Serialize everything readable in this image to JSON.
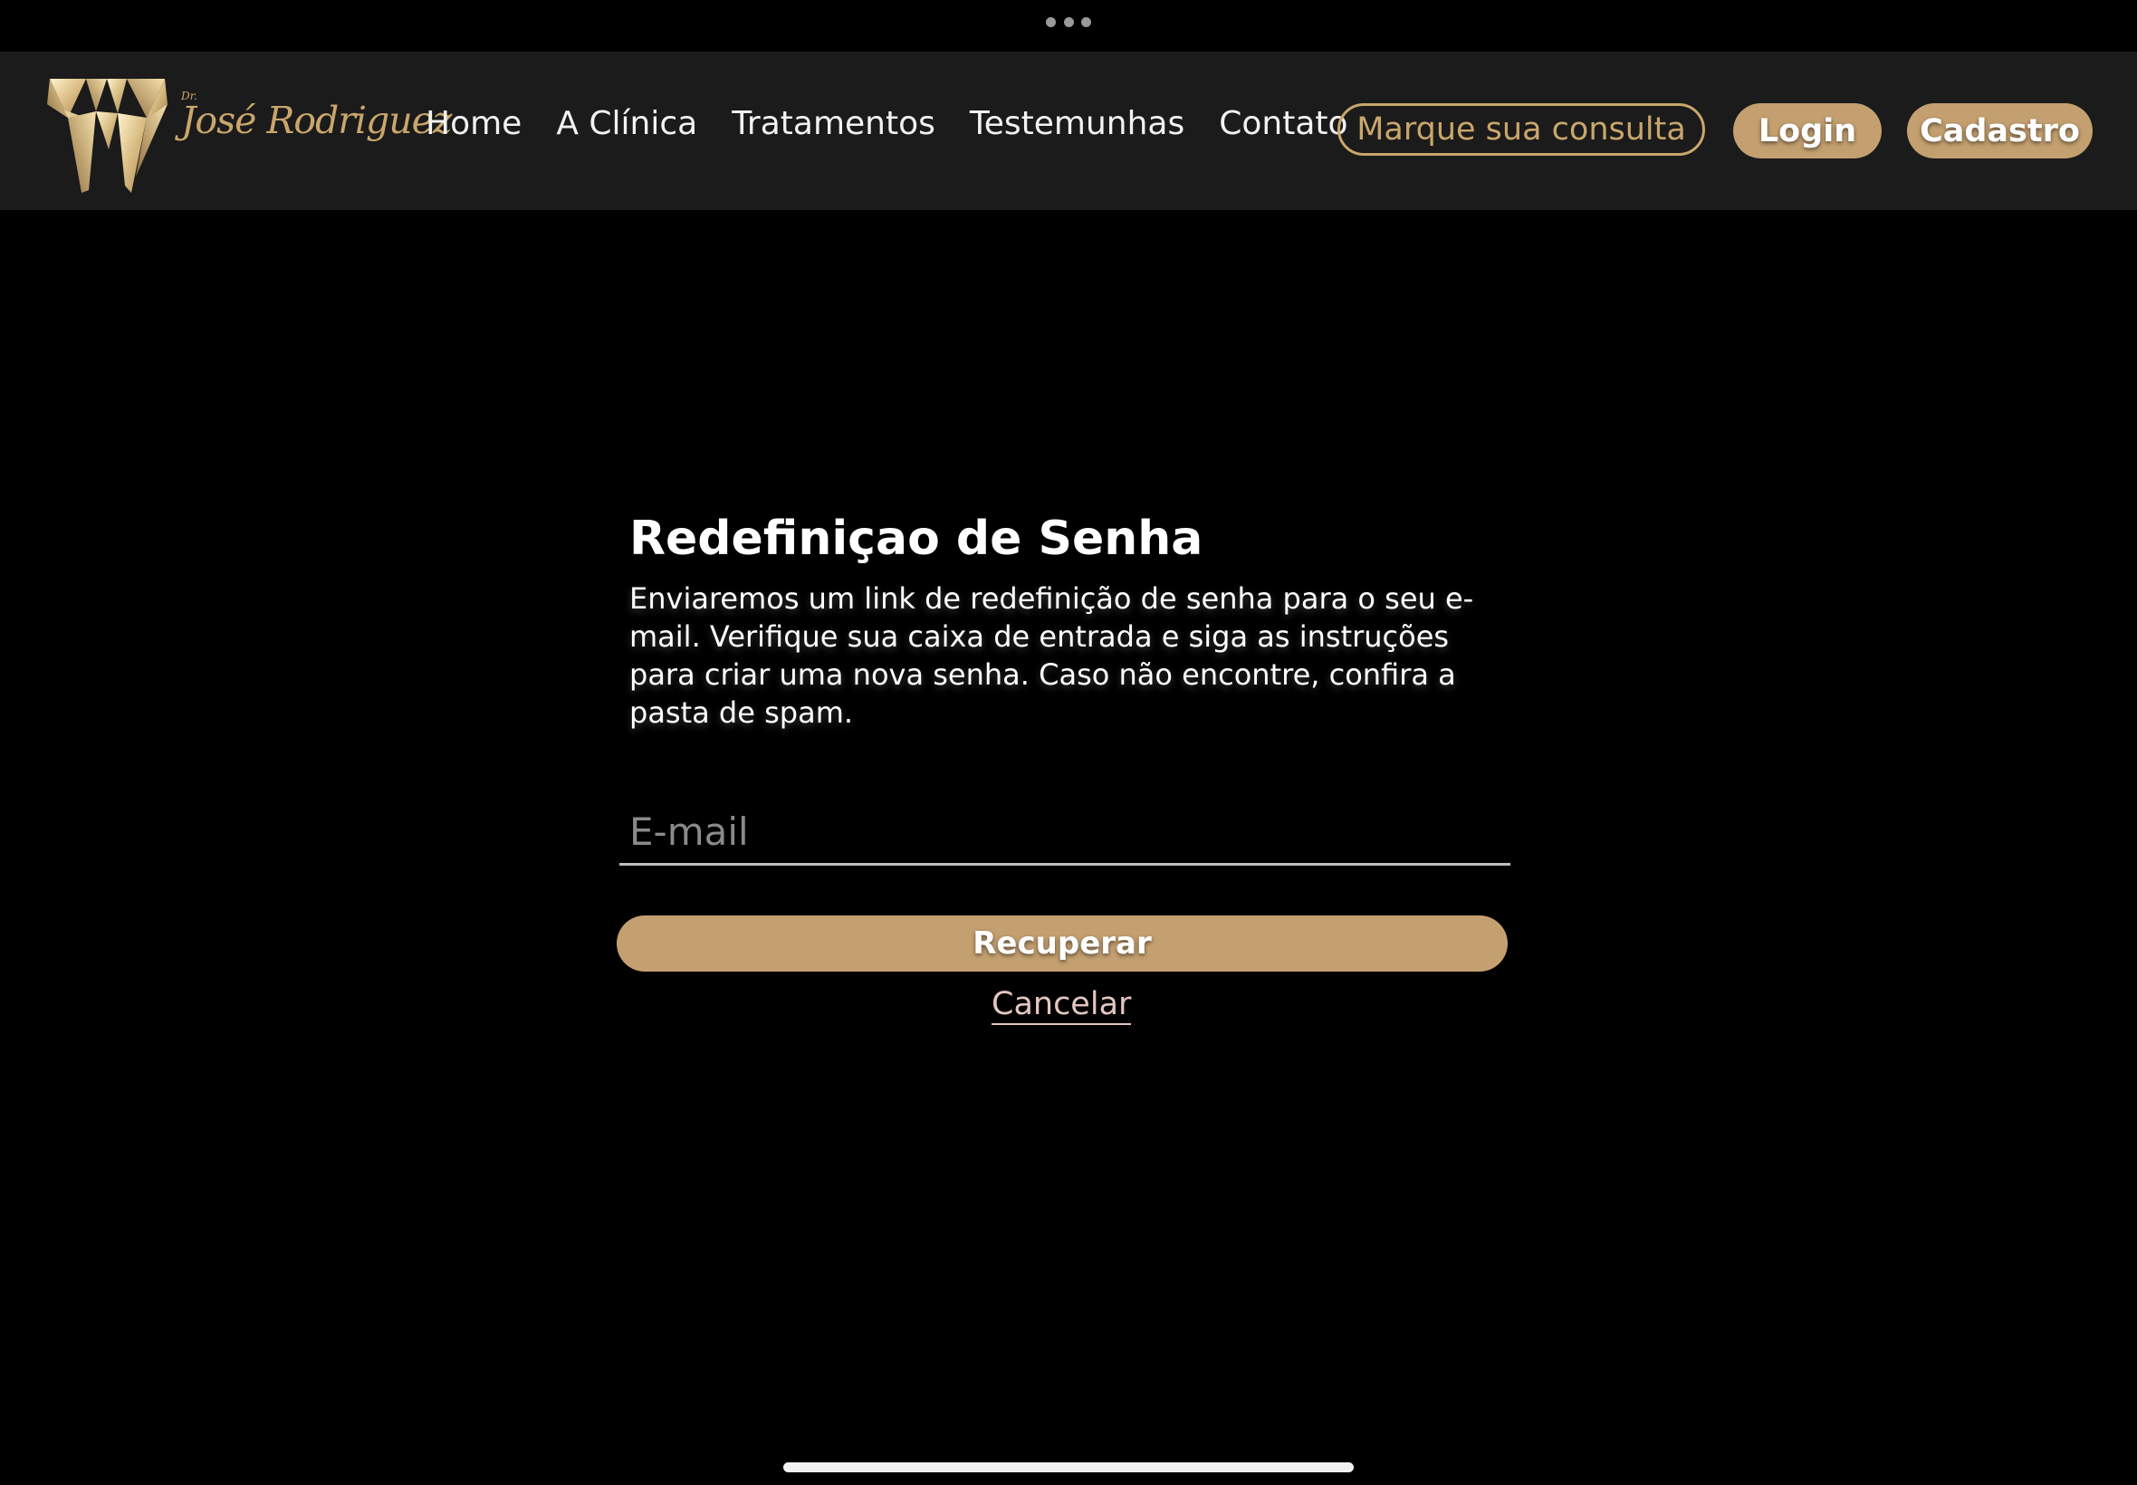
{
  "brand": {
    "prefix": "Dr.",
    "name": "José Rodriguez",
    "colors": {
      "gold": "#c9a66b",
      "button": "#c4a070",
      "navbar": "#1b1b1b",
      "background": "#000000"
    },
    "logo_icon": "diamond-tooth-logo"
  },
  "nav": {
    "links": [
      "Home",
      "A Clínica",
      "Tratamentos",
      "Testemunhas",
      "Contato"
    ],
    "appointment_button": "Marque sua consulta",
    "login_button": "Login",
    "signup_button": "Cadastro"
  },
  "reset": {
    "title": "Redefiniçao de Senha",
    "description": "Enviaremos um link de redefinição de senha para o seu e-mail. Verifique sua caixa de entrada e siga as instruções para criar uma nova senha. Caso não encontre, confira a pasta de spam.",
    "email_placeholder": "E-mail",
    "email_value": "",
    "submit_button": "Recuperar",
    "cancel_link": "Cancelar"
  }
}
